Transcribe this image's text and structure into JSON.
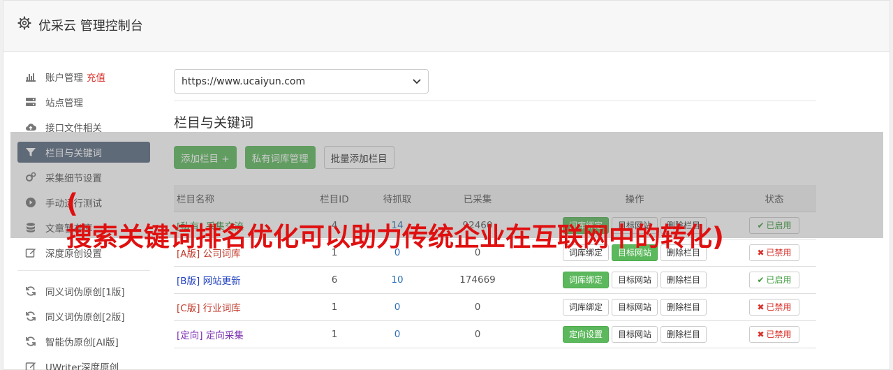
{
  "app": {
    "title": "优采云 管理控制台",
    "icon": "gear-icon"
  },
  "sidebar": {
    "group1": [
      {
        "label": "账户管理",
        "extra": "充值",
        "icon": "bar-chart-icon"
      },
      {
        "label": "站点管理",
        "icon": "server-icon"
      },
      {
        "label": "接口文件相关",
        "icon": "cloud-upload-icon"
      },
      {
        "label": "栏目与关键词",
        "icon": "filter-icon",
        "active": true
      },
      {
        "label": "采集细节设置",
        "icon": "cogs-icon"
      },
      {
        "label": "手动运行测试",
        "icon": "play-circle-icon"
      },
      {
        "label": "文章暂存库",
        "icon": "database-icon"
      },
      {
        "label": "深度原创设置",
        "icon": "edit-icon"
      }
    ],
    "group2": [
      {
        "label": "同义词伪原创[1版]",
        "icon": "refresh-icon"
      },
      {
        "label": "同义词伪原创[2版]",
        "icon": "refresh-icon"
      },
      {
        "label": "智能伪原创[AI版]",
        "icon": "refresh-icon"
      },
      {
        "label": "UWriter深度原创",
        "icon": "edit-icon"
      }
    ]
  },
  "main": {
    "site_select": {
      "value": "https://www.ucaiyun.com"
    },
    "section_title": "栏目与关键词",
    "buttons": {
      "add_column": "添加栏目 +",
      "private_lib": "私有词库管理",
      "batch_add": "批量添加栏目"
    },
    "table": {
      "headers": [
        "栏目名称",
        "栏目ID",
        "待抓取",
        "已采集",
        "操作",
        "状态"
      ],
      "rows": [
        {
          "tag": "[私有]",
          "name": "采集交流",
          "color": "#3a8a3a",
          "id": "4",
          "pending": "14",
          "collected": "92460",
          "op1": "词库绑定",
          "op1_green": true,
          "op2": "目标网站",
          "op3": "删除栏目",
          "status": "已启用",
          "enabled": true
        },
        {
          "tag": "[A版]",
          "name": "公司词库",
          "color": "#c0392b",
          "id": "1",
          "pending": "0",
          "collected": "0",
          "op1": "词库绑定",
          "op1_green": false,
          "op2": "目标网站",
          "op2_green": true,
          "op3": "删除栏目",
          "status": "已禁用",
          "enabled": false
        },
        {
          "tag": "[B版]",
          "name": "网站更新",
          "color": "#1f3fbf",
          "id": "6",
          "pending": "10",
          "collected": "174669",
          "op1": "词库绑定",
          "op1_green": true,
          "op2": "目标网站",
          "op3": "删除栏目",
          "status": "已启用",
          "enabled": true
        },
        {
          "tag": "[C版]",
          "name": "行业词库",
          "color": "#c0392b",
          "id": "1",
          "pending": "0",
          "collected": "0",
          "op1": "词库绑定",
          "op1_green": false,
          "op2": "目标网站",
          "op3": "删除栏目",
          "status": "已禁用",
          "enabled": false
        },
        {
          "tag": "[定向]",
          "name": "定向采集",
          "color": "#7b2fb0",
          "id": "1",
          "pending": "0",
          "collected": "0",
          "op1": "定向设置",
          "op1_green": true,
          "op2": "目标网站",
          "op3": "删除栏目",
          "status": "已禁用",
          "enabled": false
        }
      ]
    }
  },
  "overlay": {
    "text": "(\n搜索关键词排名优化可以助力传统企业在互联网中的转化)"
  },
  "colors": {
    "accent_green": "#5cb85c",
    "active_nav": "#5a6b82",
    "danger": "#d9302a",
    "overlay_text": "#e01010"
  }
}
